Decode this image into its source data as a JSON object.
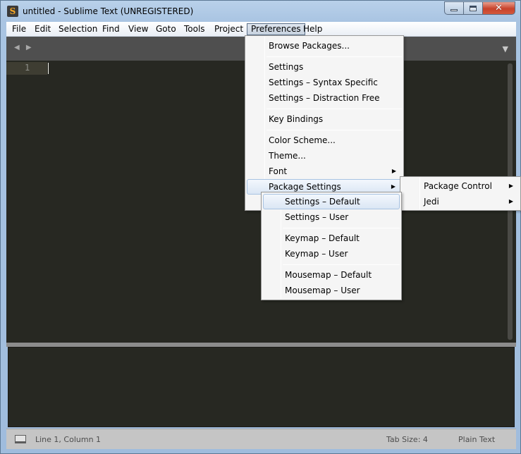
{
  "window": {
    "title": "untitled - Sublime Text (UNREGISTERED)",
    "icon_glyph": "S"
  },
  "window_buttons": {
    "close_glyph": "✕"
  },
  "menubar": {
    "items": [
      "File",
      "Edit",
      "Selection",
      "Find",
      "View",
      "Goto",
      "Tools",
      "Project",
      "Preferences",
      "Help"
    ],
    "active": "Preferences"
  },
  "tabbar": {
    "nav_glyph": "◀ ▶",
    "dropdown_glyph": "▼"
  },
  "editor": {
    "line_number": "1"
  },
  "preferences_menu": {
    "items": [
      {
        "label": "Browse Packages..."
      },
      {
        "label": "Settings"
      },
      {
        "label": "Settings – Syntax Specific"
      },
      {
        "label": "Settings – Distraction Free"
      },
      {
        "label": "Key Bindings"
      },
      {
        "label": "Color Scheme..."
      },
      {
        "label": "Theme..."
      },
      {
        "label": "Font",
        "submenu": true
      },
      {
        "label": "Package Settings",
        "submenu": true,
        "highlighted": true
      }
    ]
  },
  "package_settings_menu": {
    "items": [
      {
        "label": "Package Control",
        "submenu": true
      },
      {
        "label": "Jedi",
        "submenu": true
      }
    ]
  },
  "package_submenu": {
    "items": [
      {
        "label": "Settings – Default",
        "highlighted": true
      },
      {
        "label": "Settings – User"
      },
      {
        "label": "Keymap – Default"
      },
      {
        "label": "Keymap – User"
      },
      {
        "label": "Mousemap – Default"
      },
      {
        "label": "Mousemap – User"
      }
    ]
  },
  "statusbar": {
    "position": "Line 1, Column 1",
    "tab_size": "Tab Size: 4",
    "syntax": "Plain Text"
  },
  "icons": {
    "app": "sublime-text-icon",
    "minimize": "minimize-icon",
    "maximize": "maximize-icon",
    "close": "close-icon",
    "submenu_arrow": "▶",
    "status_panel": "panel-toggle-icon"
  },
  "colors": {
    "editor_bg": "#272822",
    "menu_highlight": "#dae6f4",
    "frame": "#a9c4e2"
  }
}
